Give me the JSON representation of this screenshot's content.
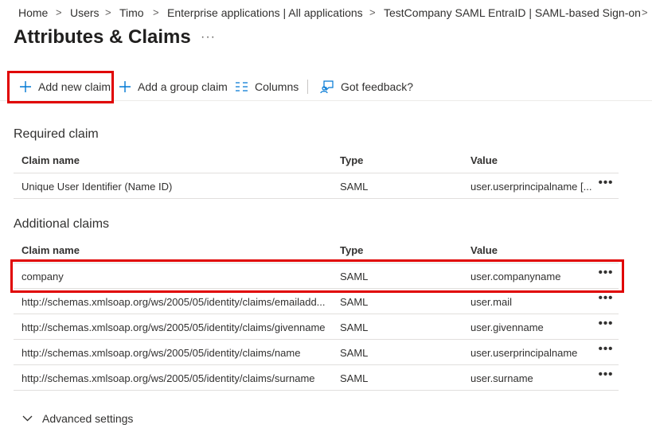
{
  "breadcrumb": {
    "items": [
      "Home",
      "Users",
      "Timo",
      "Enterprise applications | All applications",
      "TestCompany SAML EntraID | SAML-based Sign-on"
    ],
    "separator": ">"
  },
  "page": {
    "title": "Attributes & Claims",
    "more_label": "···"
  },
  "toolbar": {
    "add_new_claim": "Add new claim",
    "add_group_claim": "Add a group claim",
    "columns": "Columns",
    "feedback": "Got feedback?"
  },
  "required": {
    "title": "Required claim",
    "headers": {
      "name": "Claim name",
      "type": "Type",
      "value": "Value"
    },
    "rows": [
      {
        "name": "Unique User Identifier (Name ID)",
        "type": "SAML",
        "value": "user.userprincipalname [..."
      }
    ]
  },
  "additional": {
    "title": "Additional claims",
    "headers": {
      "name": "Claim name",
      "type": "Type",
      "value": "Value"
    },
    "rows": [
      {
        "name": "company",
        "type": "SAML",
        "value": "user.companyname"
      },
      {
        "name": "http://schemas.xmlsoap.org/ws/2005/05/identity/claims/emailadd...",
        "type": "SAML",
        "value": "user.mail"
      },
      {
        "name": "http://schemas.xmlsoap.org/ws/2005/05/identity/claims/givenname",
        "type": "SAML",
        "value": "user.givenname"
      },
      {
        "name": "http://schemas.xmlsoap.org/ws/2005/05/identity/claims/name",
        "type": "SAML",
        "value": "user.userprincipalname"
      },
      {
        "name": "http://schemas.xmlsoap.org/ws/2005/05/identity/claims/surname",
        "type": "SAML",
        "value": "user.surname"
      }
    ]
  },
  "advanced": {
    "label": "Advanced settings"
  },
  "more_glyph": "•••",
  "colors": {
    "highlight": "#e00000",
    "accent": "#0078d4",
    "text": "#323130"
  },
  "icons": {
    "add": "plus-icon",
    "columns": "columns-icon",
    "feedback": "feedback-icon",
    "expand": "chevron-down-icon"
  }
}
